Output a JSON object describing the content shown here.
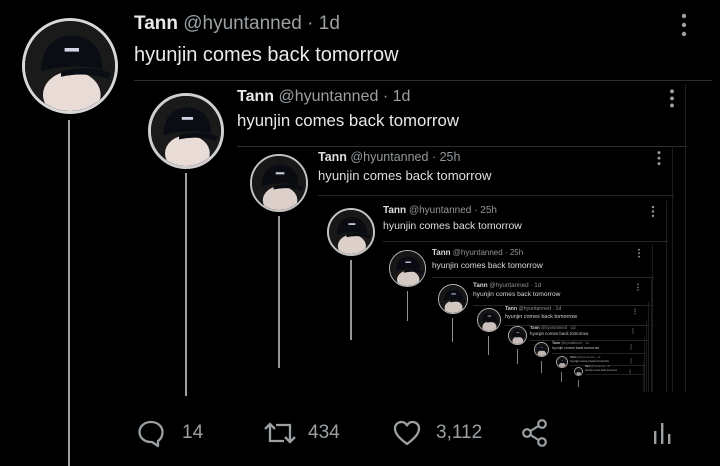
{
  "tweet": {
    "name": "Tann",
    "handle": "@hyuntanned",
    "dot": "·",
    "time": "1d",
    "text": "hyunjin comes back tomorrow",
    "more_icon": "more-vertical-icon",
    "actions": {
      "replies": "14",
      "retweets": "434",
      "likes": "3,112"
    }
  },
  "nested": [
    {
      "name": "Tann",
      "handle": "@hyuntanned",
      "dot": "·",
      "time": "1d",
      "text": "hyunjin comes back tomorrow"
    },
    {
      "name": "Tann",
      "handle": "@hyuntanned",
      "dot": "·",
      "time": "25h",
      "text": "hyunjin comes back tomorrow"
    },
    {
      "name": "Tann",
      "handle": "@hyuntanned",
      "dot": "·",
      "time": "25h",
      "text": "hyunjin comes back tomorrow"
    },
    {
      "name": "Tann",
      "handle": "@hyuntanned",
      "dot": "·",
      "time": "25h",
      "text": "hyunjin comes back tomorrow"
    },
    {
      "name": "Tann",
      "handle": "@hyuntanned",
      "dot": "·",
      "time": "1d",
      "text": "hyunjin comes back tomorrow"
    },
    {
      "name": "Tann",
      "handle": "@hyuntanned",
      "dot": "·",
      "time": "1d",
      "text": "hyunjin comes back tomorrow"
    },
    {
      "name": "Tann",
      "handle": "@hyuntanned",
      "dot": "·",
      "time": "1d",
      "text": "hyunjin comes back tomorrow"
    },
    {
      "name": "Tann",
      "handle": "@hyuntanned",
      "dot": "·",
      "time": "1d",
      "text": "hyunjin comes back tomorrow"
    },
    {
      "name": "Tann",
      "handle": "@hyuntanned",
      "dot": "·",
      "time": "1d",
      "text": "hyunjin comes back tomorrow"
    },
    {
      "name": "Tann",
      "handle": "@hyuntanned",
      "dot": "·",
      "time": "1d",
      "text": "hyunjin comes back tomorrow"
    }
  ],
  "colors": {
    "background": "#000000",
    "text": "#e7e9ea",
    "muted": "#9aa0a4",
    "separator": "#2a2d30"
  },
  "icons": {
    "reply": "reply-icon",
    "retweet": "retweet-icon",
    "like": "heart-icon",
    "share": "share-icon",
    "analytics": "analytics-icon",
    "more": "more-vertical-icon"
  }
}
